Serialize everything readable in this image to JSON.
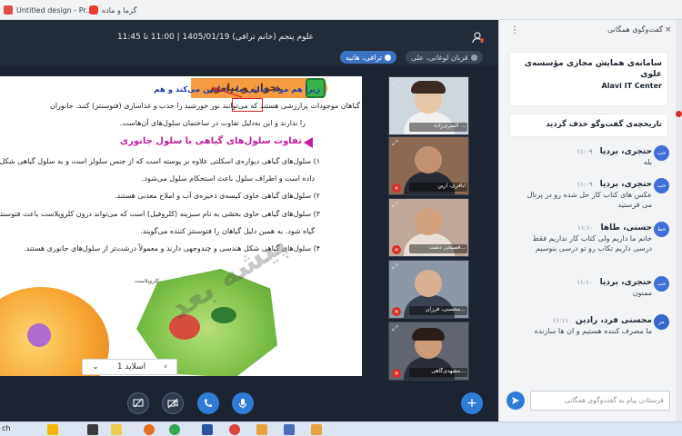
{
  "browser": {
    "bookmarks": [
      {
        "label": "Untitled design - Pr...",
        "icon": "canva-icon"
      },
      {
        "label": "گزما و ماده",
        "icon": "video-icon"
      }
    ]
  },
  "meeting": {
    "title": "علوم پنجم (خانم ترافی) 1405/01/19 | 11:00 تا 11:45",
    "participants_chip": "ترافی، هانیه",
    "secondary_chip": "قربان لوغانی، علی",
    "toolbar_icons": [
      "users-icon",
      "layout-icon"
    ]
  },
  "slide": {
    "title_badge": "بخوان و بیاموز",
    "line_top": "زیرا هم مواد غذایی ما را تامین می‌کند و هم",
    "para1": "گیاهان موجودات پرارزشی هستند که می‌توانند نور خورشید را جذب و غذاسازی (فتوسنتز) کنند. جانوران",
    "para2": "را ندارند و این به‌دلیل تفاوت در ساختمان سلول‌های آن‌هاست.",
    "heading": "تفاوت سلول‌های گیاهی با سلول جانوری",
    "item1a": "۱) سلول‌های گیاهی دیواره‌ی اسکلتی علاوه بر پوسته است که از جنس سلولز است و به سلول گیاهی شکل",
    "item1b": "داده است و اطراف سلول باعث استحکام سلول می‌شود.",
    "item2": "۲) سلول‌های گیاهی حاوی کیسه‌ی ذخیره‌ی آب و املاح معدنی هستند.",
    "item3a": "۳) سلول‌های گیاهی حاوی بخشی به نام سبزینه (کلروفیل) است که می‌تواند درون کلروپلاست باعث فتوسنتز",
    "item3b": "گیاه شود. به همین دلیل گیاهان را فتوسنتز کننده می‌گویند.",
    "item4": "۴) سلول‌های گیاهی شکل هندسی و چندوجهی دارند و معمولاً درشت‌تر از سلول‌های جانوری هستند.",
    "watermark": "پیشه بعد",
    "slide_label": "اسلاید 1",
    "small_label": "کلروپلاست"
  },
  "tiles": [
    {
      "name": "السری‌زاده ...",
      "face": "#e6c6a8",
      "body": "#f1f1f1",
      "bg": "#cfd7de"
    },
    {
      "name": "اباقری، آرین",
      "face": "#c49272",
      "body": "#272b33",
      "bg": "#8a6a54"
    },
    {
      "name": "قصیحی دشت...",
      "face": "#d1a07c",
      "body": "#e8e0d6",
      "bg": "#bfa79a"
    },
    {
      "name": "محسنی، فرزان...",
      "face": "#d7b191",
      "body": "#3a4150",
      "bg": "#8d98a7"
    },
    {
      "name": "مشهدی‌گاهی...",
      "face": "#cc9b79",
      "body": "#2a2e38",
      "bg": "#60656f"
    }
  ],
  "controls": [
    "screen-share-icon",
    "camera-off-icon",
    "phone-icon",
    "microphone-icon",
    "add-icon"
  ],
  "chat": {
    "header": "گفت‌وگوی همگانی",
    "announcement_text": "سامانه‌ی همایش مجازی مؤسسه‌ی علوی",
    "announcement_sub": "Alavi IT Center",
    "clear_history": "تاریخچه‌ی گفت‌وگو حذف گردید",
    "messages": [
      {
        "sender": "حنجری، بردیا",
        "time": "۱۱:۰۹",
        "text": "بله",
        "avatar": "حب"
      },
      {
        "sender": "حنجری، بردیا",
        "time": "۱۱:۰۹",
        "text": "عکس های کتاب کار حل شده رو در پرتال می فرستید",
        "avatar": "حب"
      },
      {
        "sender": "حسنی، طاها",
        "time": "۱۱:۱۰",
        "text": "خانم ما داریم ولی کتاب کار نداریم فقط درسی داریم تکاب رو تو درسی بنوسیم",
        "avatar": "حط"
      },
      {
        "sender": "حنجری، بردیا",
        "time": "۱۱:۱۰",
        "text": "ممنون",
        "avatar": "حب"
      },
      {
        "sender": "محسنی فرد، رادین",
        "time": "۱۱:۱۱",
        "text": "ما مصرف کننده هستیم و ان ها سازنده",
        "avatar": "مر"
      }
    ],
    "input_placeholder": "فرستادن پیام به گفت‌وگوی همگانی",
    "send_icon": "send-icon"
  },
  "taskbar": {
    "search_text": "ch",
    "apps": [
      "chrome-icon",
      "word-icon",
      "firefox-icon",
      "files-icon"
    ]
  },
  "colors": {
    "accent": "#2e7cd6",
    "record": "#d93025",
    "slide_heading": "#c0209a"
  }
}
